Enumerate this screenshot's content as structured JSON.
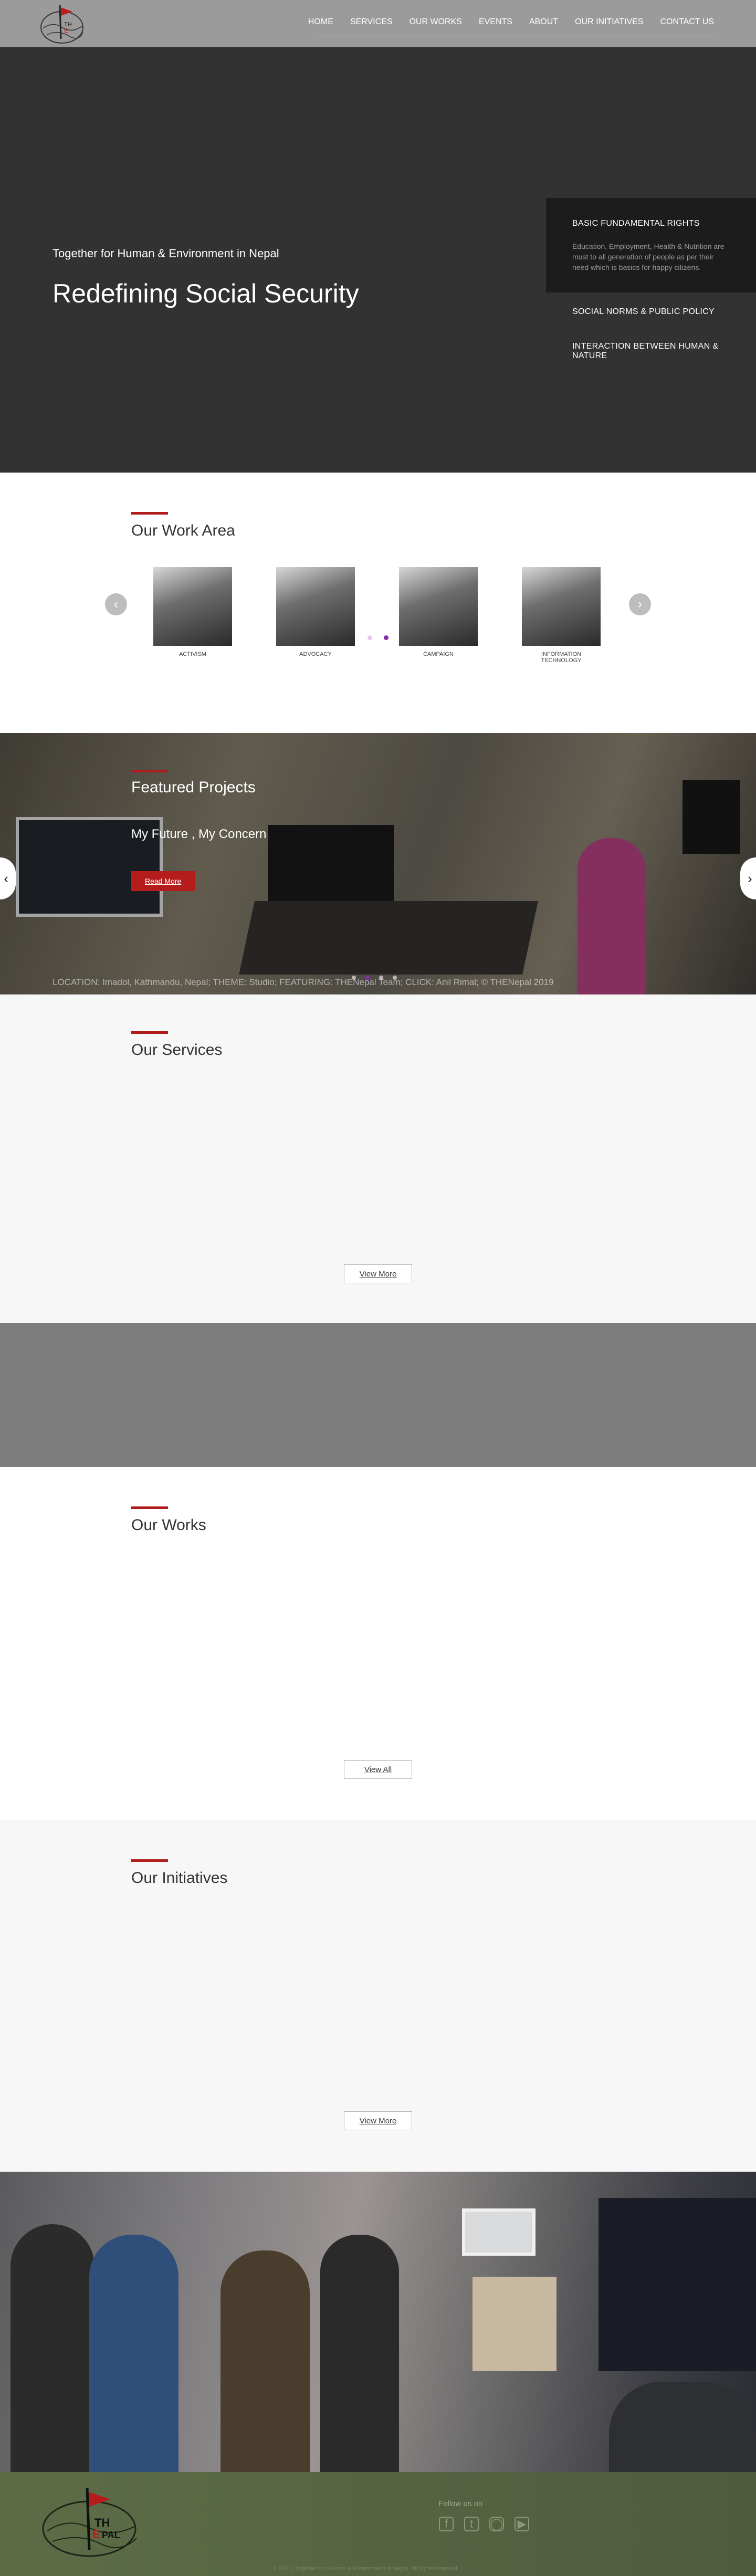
{
  "header": {
    "nav": [
      "HOME",
      "SERVICES",
      "OUR WORKS",
      "EVENTS",
      "ABOUT",
      "OUR INITIATIVES",
      "CONTACT US"
    ],
    "logo_text": "THE NEPAL"
  },
  "hero": {
    "subtitle": "Together for Human & Environment in Nepal",
    "title": "Redefining Social Security",
    "panel": [
      {
        "title": "BASIC FUNDAMENTAL RIGHTS",
        "desc": "Education, Employment, Health & Nutrition are must to all generation of people as per their need which is basics for happy citizens."
      },
      {
        "title": "SOCIAL NORMS & PUBLIC POLICY"
      },
      {
        "title": "INTERACTION BETWEEN HUMAN & NATURE"
      }
    ]
  },
  "work_area": {
    "heading": "Our Work Area",
    "items": [
      "ACTIVISM",
      "ADVOCACY",
      "CAMPAIGN",
      "INFORMATION TECHNOLOGY"
    ],
    "prev_icon": "chevron-left-icon",
    "next_icon": "chevron-right-icon"
  },
  "featured": {
    "heading": "Featured Projects",
    "project": "My Future , My Concern",
    "button": "Read More",
    "caption": "LOCATION: Imadol, Kathmandu, Nepal; THEME: Studio; FEATURING: THENepal Team; CLICK: Anil Rimal; © THENepal 2019"
  },
  "services": {
    "heading": "Our Services",
    "button": "View More"
  },
  "works": {
    "heading": "Our Works",
    "button": "View All"
  },
  "initiatives": {
    "heading": "Our Initiatives",
    "button": "View More"
  },
  "footer": {
    "follow": "Follow us on",
    "socials": [
      "facebook-icon",
      "twitter-icon",
      "instagram-icon",
      "youtube-icon"
    ],
    "copyright": "© 2020, Together for Human & Environment in Nepal. All rights reserved."
  },
  "colors": {
    "accent": "#b01c1c",
    "carousel_dot": "#8a2aa8",
    "hero_bg": "#323232"
  }
}
